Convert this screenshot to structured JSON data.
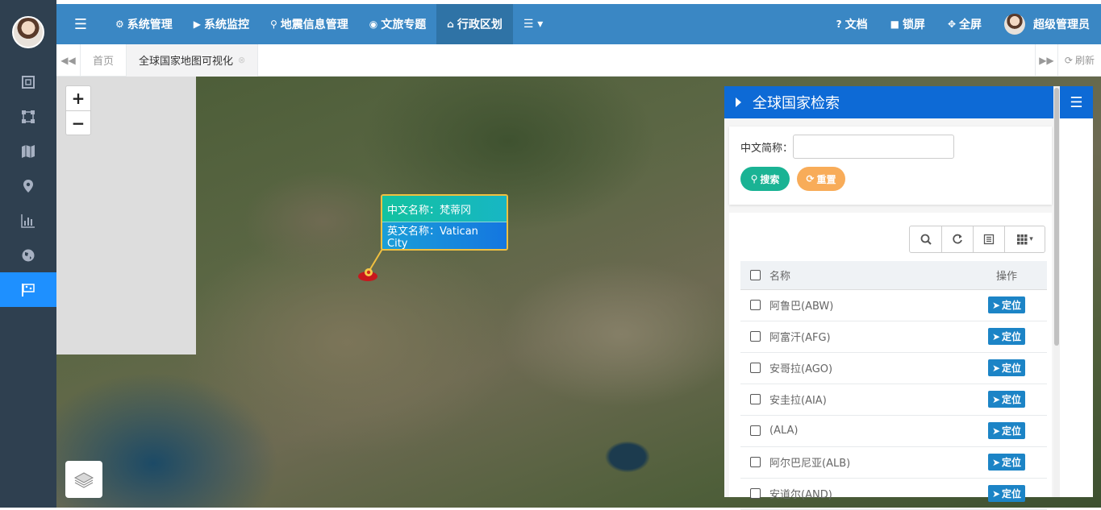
{
  "sidebar": {
    "items": [
      {
        "icon": "frame-icon"
      },
      {
        "icon": "nodes-icon"
      },
      {
        "icon": "map-icon"
      },
      {
        "icon": "pin-icon"
      },
      {
        "icon": "bar-chart-icon"
      },
      {
        "icon": "globe-icon"
      },
      {
        "icon": "flag-icon",
        "active": true
      }
    ]
  },
  "topbar": {
    "nav": [
      {
        "icon": "gear-icon",
        "glyph": "⚙",
        "label": "系统管理"
      },
      {
        "icon": "video-icon",
        "glyph": "▶",
        "label": "系统监控"
      },
      {
        "icon": "pin-icon",
        "glyph": "⚲",
        "label": "地震信息管理"
      },
      {
        "icon": "globe-icon",
        "glyph": "◉",
        "label": "文旅专题"
      },
      {
        "icon": "bank-icon",
        "glyph": "⌂",
        "label": "行政区划",
        "active": true
      }
    ],
    "more_icon": "list-menu-icon",
    "right": [
      {
        "icon": "question-icon",
        "glyph": "?",
        "label": "文档"
      },
      {
        "icon": "lock-icon",
        "glyph": "■",
        "label": "锁屏"
      },
      {
        "icon": "expand-icon",
        "glyph": "✥",
        "label": "全屏"
      }
    ],
    "user": "超级管理员"
  },
  "tabs": {
    "items": [
      {
        "label": "首页"
      },
      {
        "label": "全球国家地图可视化",
        "active": true,
        "closable": true
      }
    ],
    "refresh_label": "刷新"
  },
  "map": {
    "zoom_in": "+",
    "zoom_out": "−",
    "popup": {
      "cn_line": "中文名称：梵蒂冈",
      "en_line": "英文名称：Vatican City"
    }
  },
  "panel": {
    "title": "全球国家检索",
    "search_label": "中文简称：",
    "search_value": "",
    "search_button": "搜索",
    "reset_button": "重置",
    "columns": [
      "名称",
      "操作"
    ],
    "rows": [
      {
        "name": "阿鲁巴(ABW)",
        "action": "定位"
      },
      {
        "name": "阿富汗(AFG)",
        "action": "定位"
      },
      {
        "name": "安哥拉(AGO)",
        "action": "定位"
      },
      {
        "name": "安圭拉(AIA)",
        "action": "定位"
      },
      {
        "name": "(ALA)",
        "action": "定位"
      },
      {
        "name": "阿尔巴尼亚(ALB)",
        "action": "定位"
      },
      {
        "name": "安道尔(AND)",
        "action": "定位"
      }
    ]
  },
  "colors": {
    "sidebar_bg": "#2f4050",
    "topbar_bg": "#3a87c4",
    "accent": "#1e90ff",
    "panel_head": "#0d6ad6",
    "search_btn": "#1ab394",
    "reset_btn": "#f8ac59",
    "locate_btn": "#1c84c6"
  }
}
